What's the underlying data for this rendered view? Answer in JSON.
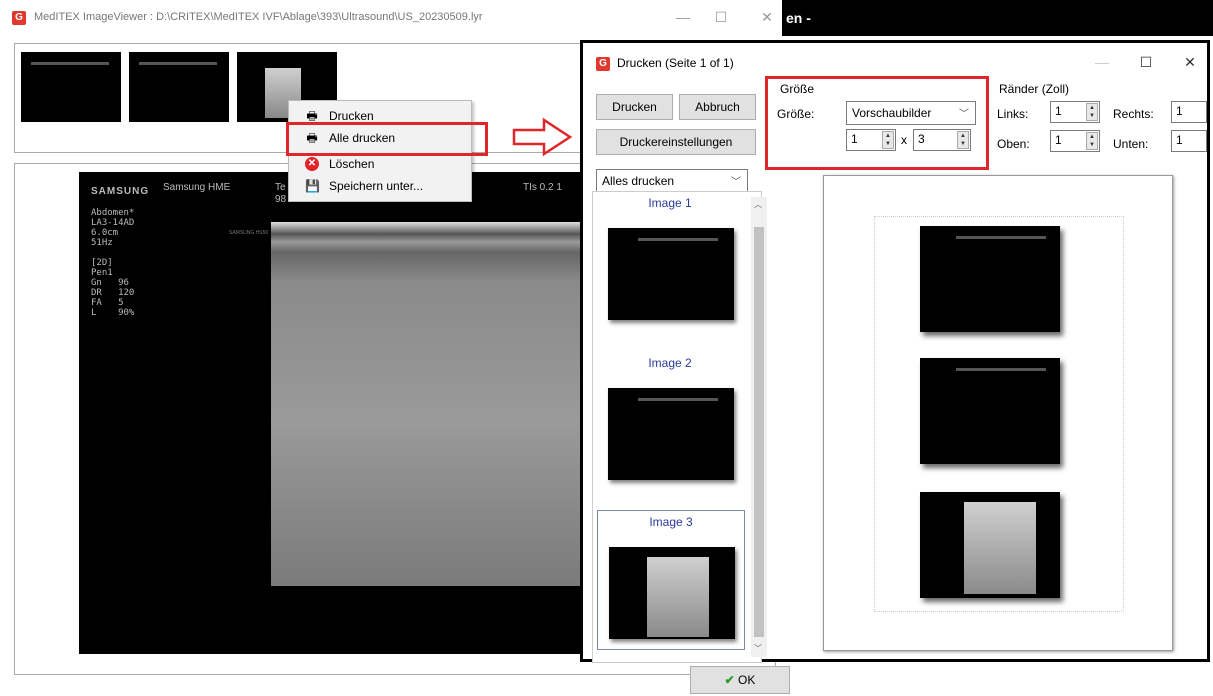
{
  "background_window": {
    "title_fragment": "en -"
  },
  "viewer": {
    "title": "MedITEX ImageViewer : D:\\CRITEX\\MedITEX IVF\\Ablage\\393\\Ultrasound\\US_20230509.lyr",
    "minimize": "—",
    "maximize": "☐",
    "close": "✕",
    "ultrasound": {
      "brand": "SAMSUNG",
      "center_top": "Samsung HME",
      "center_frag1": "Te",
      "center_frag2": "98",
      "tis_label": "TIs  0.2  1",
      "params": "Abdomen*\nLA3-14AD\n6.0cm\n51Hz\n\n[2D]\nPen1\nGn   96\nDR   120\nFA   5\nL    90%",
      "mini_label": "SAMSUNG HS50"
    }
  },
  "context_menu": {
    "items": [
      {
        "label": "Drucken",
        "icon": "printer-icon"
      },
      {
        "label": "Alle drucken",
        "icon": "print-all-icon"
      },
      {
        "label": "Löschen",
        "icon": "delete-icon"
      },
      {
        "label": "Speichern unter...",
        "icon": "save-icon"
      }
    ]
  },
  "dialog": {
    "title": "Drucken (Seite 1 of 1)",
    "minimize": "—",
    "maximize": "☐",
    "close": "✕",
    "buttons": {
      "print": "Drucken",
      "cancel": "Abbruch",
      "printer_settings": "Druckereinstellungen"
    },
    "print_mode": "Alles drucken",
    "size_group": {
      "title": "Größe",
      "label": "Größe:",
      "value": "Vorschaubilder",
      "cols": "1",
      "times": "x",
      "rows": "3"
    },
    "margins_group": {
      "title": "Ränder (Zoll)",
      "left_label": "Links:",
      "left_value": "1",
      "right_label": "Rechts:",
      "right_value": "1",
      "top_label": "Oben:",
      "top_value": "1",
      "bottom_label": "Unten:",
      "bottom_value": "1"
    },
    "images": [
      {
        "title": "Image 1"
      },
      {
        "title": "Image 2"
      },
      {
        "title": "Image 3"
      }
    ],
    "ok_label": "OK"
  },
  "colors": {
    "highlight_red": "#e0252b",
    "image_title_blue": "#2a3a9a"
  }
}
